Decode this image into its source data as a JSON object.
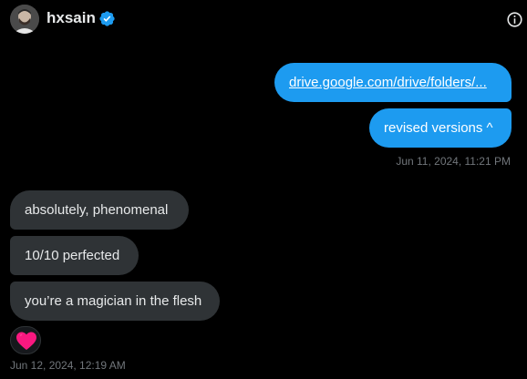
{
  "header": {
    "username": "hxsain",
    "verified_icon": "verified-badge-icon",
    "info_icon": "info-icon"
  },
  "messages": {
    "sent": [
      {
        "text": "drive.google.com/drive/folders/...",
        "type": "link"
      },
      {
        "text": "revised versions ^",
        "type": "text"
      }
    ],
    "sent_timestamp": "Jun 11, 2024, 11:21 PM",
    "received": [
      {
        "text": "absolutely, phenomenal"
      },
      {
        "text": "10/10 perfected"
      },
      {
        "text": "you’re a magician in the flesh"
      }
    ],
    "reaction_icon": "red-heart-icon",
    "received_timestamp": "Jun 12, 2024, 12:19 AM"
  },
  "colors": {
    "background": "#000000",
    "sent_bubble": "#1d9bf0",
    "received_bubble": "#2f3336",
    "timestamp": "#71767b",
    "verified": "#1d9bf0",
    "heart": "#f91880"
  }
}
